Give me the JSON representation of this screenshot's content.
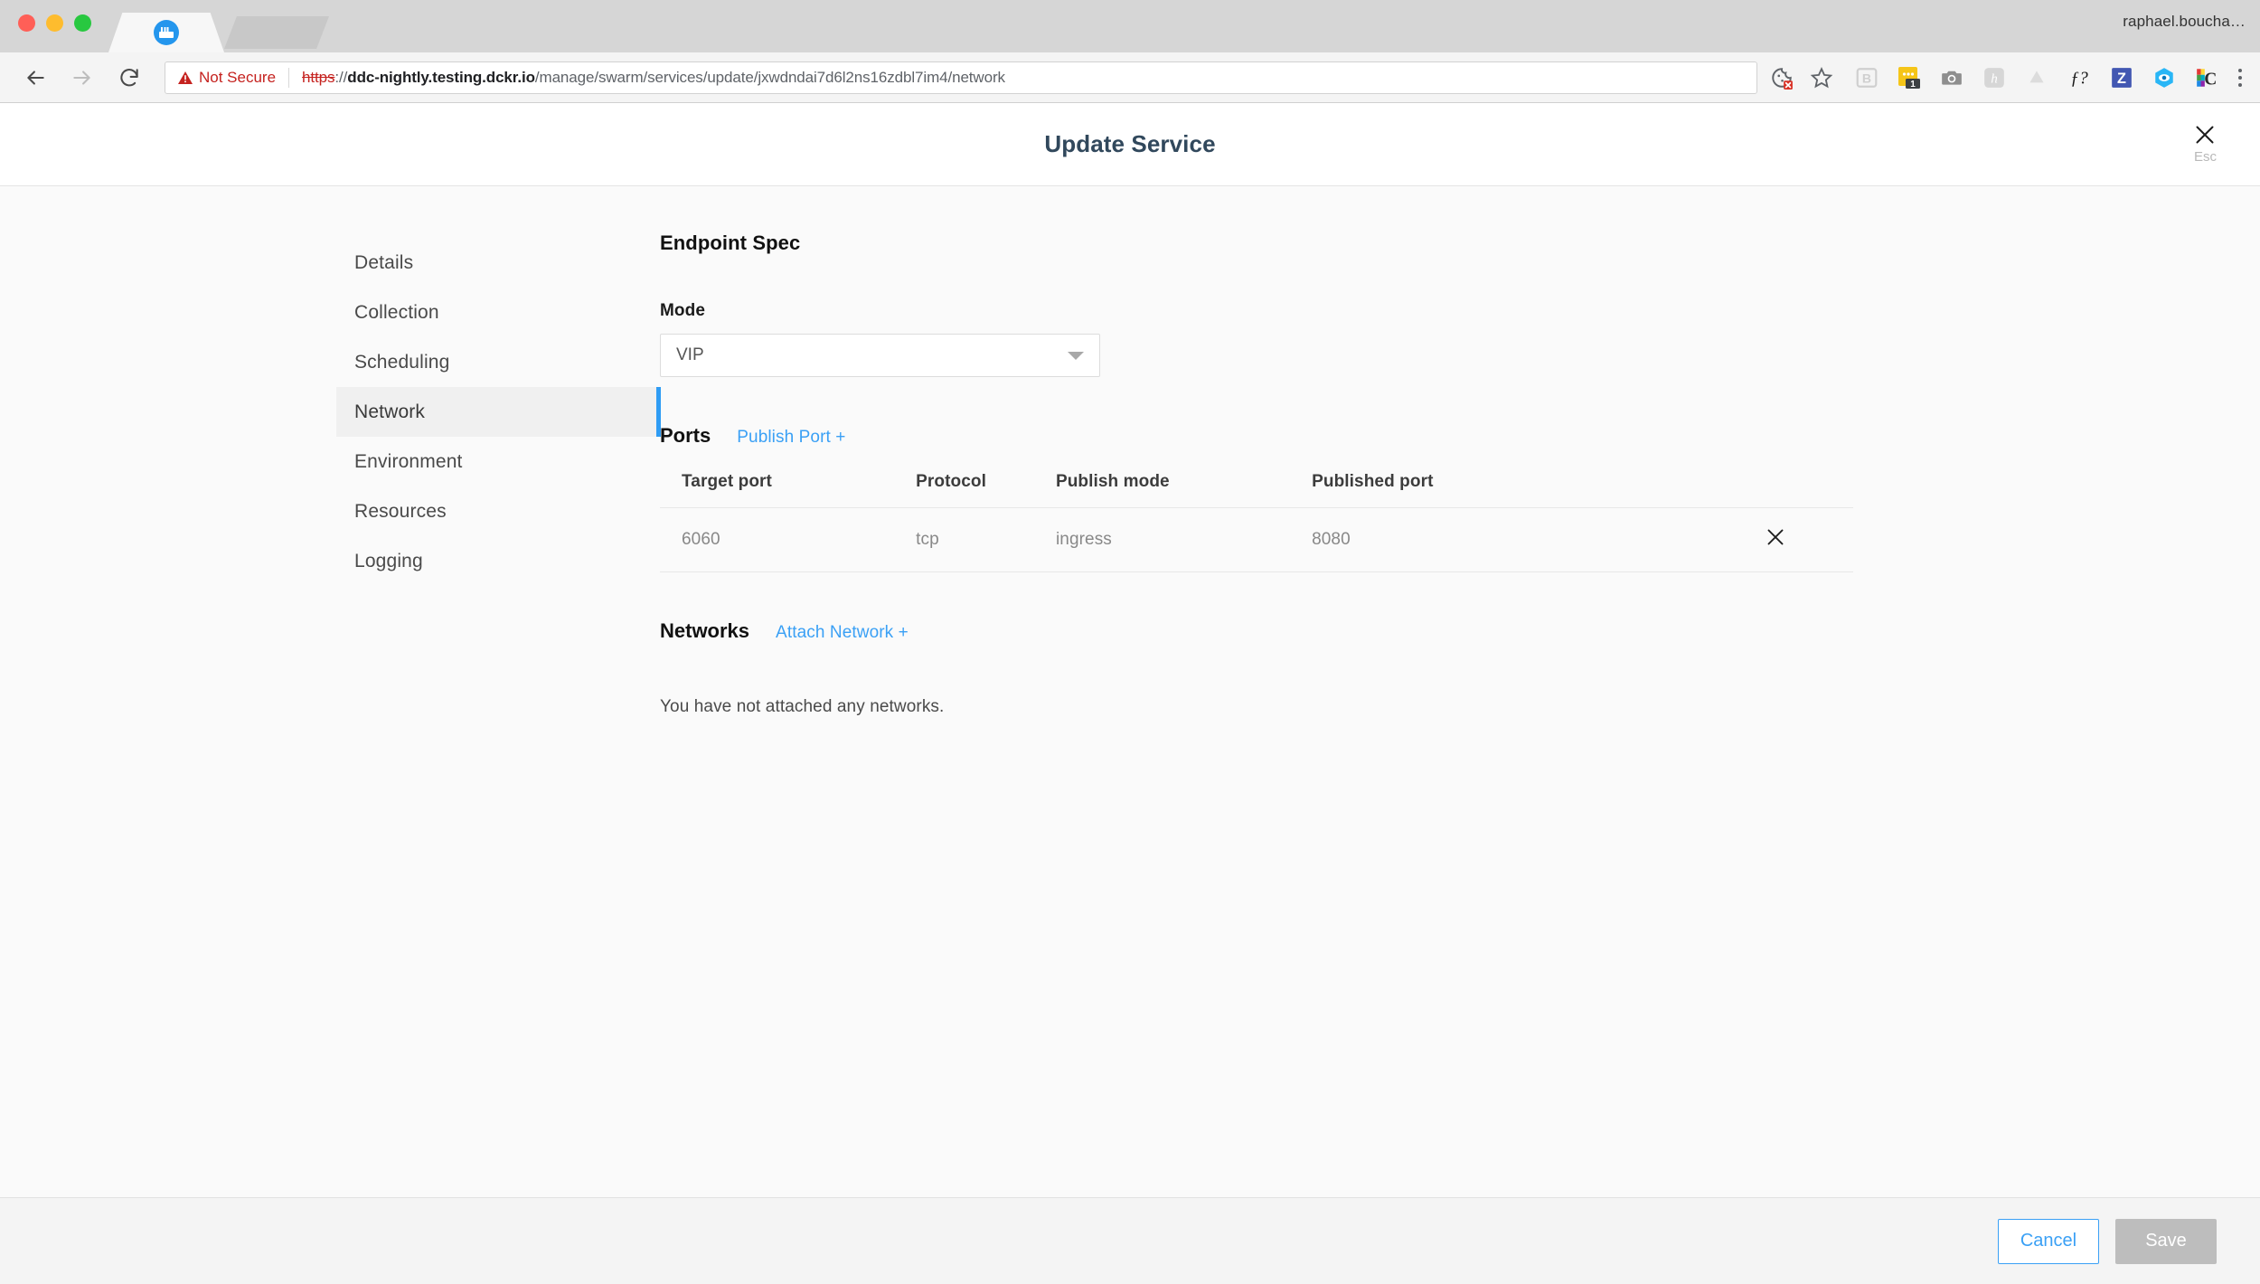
{
  "browser": {
    "user_label": "raphael.boucha…",
    "security_label": "Not Secure",
    "url": {
      "scheme": "https",
      "separator": "://",
      "host": "ddc-nightly.testing.dckr.io",
      "path": "/manage/swarm/services/update/jxwdndai7d6l2ns16zdbl7im4/network"
    },
    "nav": {
      "back": "back-icon",
      "forward": "forward-icon",
      "reload": "reload-icon"
    },
    "omnibox_actions": [
      "cookie-blocked-icon",
      "bookmark-star-icon"
    ],
    "extensions": [
      "blogger-icon",
      "notes-badge-icon",
      "screenshot-camera-icon",
      "honey-icon",
      "google-drive-icon",
      "f-question-icon",
      "zotero-icon",
      "eye-hex-icon",
      "colorzilla-icon"
    ],
    "menu": "kebab-menu-icon",
    "tabs": [
      {
        "favicon": "docker-icon",
        "active": true
      },
      {
        "favicon": "",
        "active": false
      }
    ]
  },
  "modal": {
    "title": "Update Service",
    "close_label": "Esc"
  },
  "sidebar": {
    "items": [
      {
        "label": "Details",
        "active": false
      },
      {
        "label": "Collection",
        "active": false
      },
      {
        "label": "Scheduling",
        "active": false
      },
      {
        "label": "Network",
        "active": true
      },
      {
        "label": "Environment",
        "active": false
      },
      {
        "label": "Resources",
        "active": false
      },
      {
        "label": "Logging",
        "active": false
      }
    ]
  },
  "content": {
    "endpoint_spec": {
      "heading": "Endpoint Spec",
      "mode": {
        "label": "Mode",
        "value": "VIP"
      }
    },
    "ports": {
      "heading": "Ports",
      "action_label": "Publish Port +",
      "columns": [
        "Target port",
        "Protocol",
        "Publish mode",
        "Published port"
      ],
      "rows": [
        {
          "target_port": "6060",
          "protocol": "tcp",
          "publish_mode": "ingress",
          "published_port": "8080"
        }
      ]
    },
    "networks": {
      "heading": "Networks",
      "action_label": "Attach Network +",
      "empty_message": "You have not attached any networks."
    }
  },
  "footer": {
    "cancel_label": "Cancel",
    "save_label": "Save"
  },
  "colors": {
    "accent_blue": "#3aa0f5",
    "active_bar": "#2f9cf4",
    "title_navy": "#31485c",
    "warning_red": "#c5221f",
    "save_disabled": "#bdbdbd"
  }
}
